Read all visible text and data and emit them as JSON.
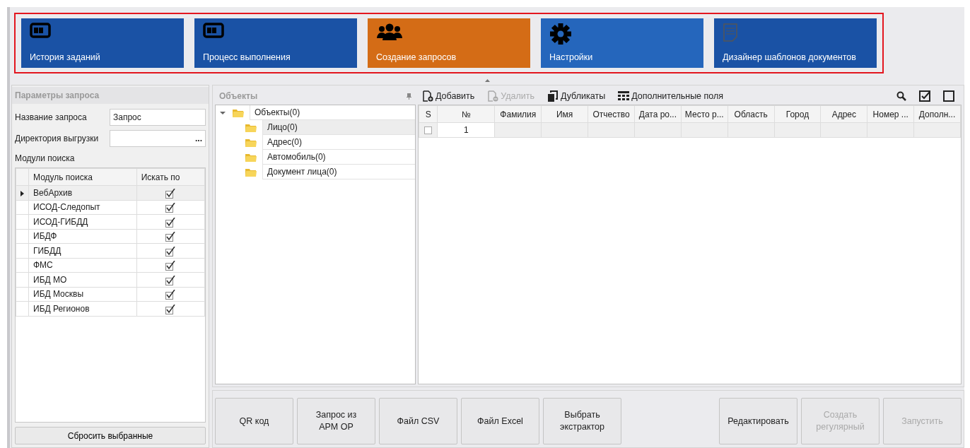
{
  "ribbon": {
    "highlighted": true,
    "tiles": [
      {
        "label": "История заданий",
        "selected": false,
        "hovered": false
      },
      {
        "label": "Процесс выполнения",
        "selected": false,
        "hovered": false
      },
      {
        "label": "Создание запросов",
        "selected": true,
        "hovered": false
      },
      {
        "label": "Настройки",
        "selected": false,
        "hovered": true
      },
      {
        "label": "Дизайнер шаблонов документов",
        "selected": false,
        "hovered": false
      }
    ]
  },
  "params": {
    "title": "Параметры запроса",
    "fields": [
      {
        "label": "Название запроса",
        "value": "Запрос",
        "kind": "text"
      },
      {
        "label": "Директория выгрузки",
        "kind": "browse",
        "button": "..."
      }
    ],
    "modules_label": "Модули поиска",
    "modules": {
      "columns": [
        "Модуль поиска",
        "Искать по"
      ],
      "rows": [
        {
          "name": "ВебАрхив",
          "checked": true,
          "selected": true
        },
        {
          "name": "ИСОД-Следопыт",
          "checked": true,
          "selected": false
        },
        {
          "name": "ИСОД-ГИБДД",
          "checked": true,
          "selected": false
        },
        {
          "name": "ИБДФ",
          "checked": true,
          "selected": false
        },
        {
          "name": "ГИБДД",
          "checked": true,
          "selected": false
        },
        {
          "name": "ФМС",
          "checked": true,
          "selected": false
        },
        {
          "name": "ИБД МО",
          "checked": true,
          "selected": false
        },
        {
          "name": "ИБД Москвы",
          "checked": true,
          "selected": false
        },
        {
          "name": "ИБД Регионов",
          "checked": true,
          "selected": false
        }
      ]
    },
    "reset_button": "Сбросить выбранные"
  },
  "objects": {
    "title": "Объекты",
    "tree": [
      {
        "label": "Объекты(0)",
        "expanded": true,
        "selected": false,
        "children": [
          {
            "label": "Лицо(0)",
            "selected": true
          },
          {
            "label": "Адрес(0)",
            "selected": false
          },
          {
            "label": "Автомобиль(0)",
            "selected": false
          },
          {
            "label": "Документ лица(0)",
            "selected": false
          }
        ]
      }
    ]
  },
  "toolbar": [
    {
      "label": "Добавить",
      "disabled": false
    },
    {
      "label": "Удалить",
      "disabled": true
    },
    {
      "label": "Дубликаты",
      "disabled": false
    },
    {
      "label": "Дополнительные поля",
      "disabled": false
    }
  ],
  "grid": {
    "columns": [
      "S",
      "№",
      "Фамилия",
      "Имя",
      "Отчество",
      "Дата ро...",
      "Место р...",
      "Область",
      "Город",
      "Адрес",
      "Номер ...",
      "Дополн..."
    ],
    "rows": [
      {
        "checked": false,
        "cells": [
          "",
          "1",
          "",
          "",
          "",
          "",
          "",
          "",
          "",
          "",
          "",
          ""
        ]
      }
    ]
  },
  "buttons_left": [
    {
      "label": "QR код",
      "disabled": false
    },
    {
      "label": "Запрос из\nАРМ ОР",
      "disabled": false
    },
    {
      "label": "Файл CSV",
      "disabled": false
    },
    {
      "label": "Файл Excel",
      "disabled": false
    },
    {
      "label": "Выбрать\nэкстрактор",
      "disabled": false
    }
  ],
  "buttons_right": [
    {
      "label": "Редактировать",
      "disabled": false
    },
    {
      "label": "Создать\nрегулярный",
      "disabled": true
    },
    {
      "label": "Запустить",
      "disabled": true
    }
  ]
}
